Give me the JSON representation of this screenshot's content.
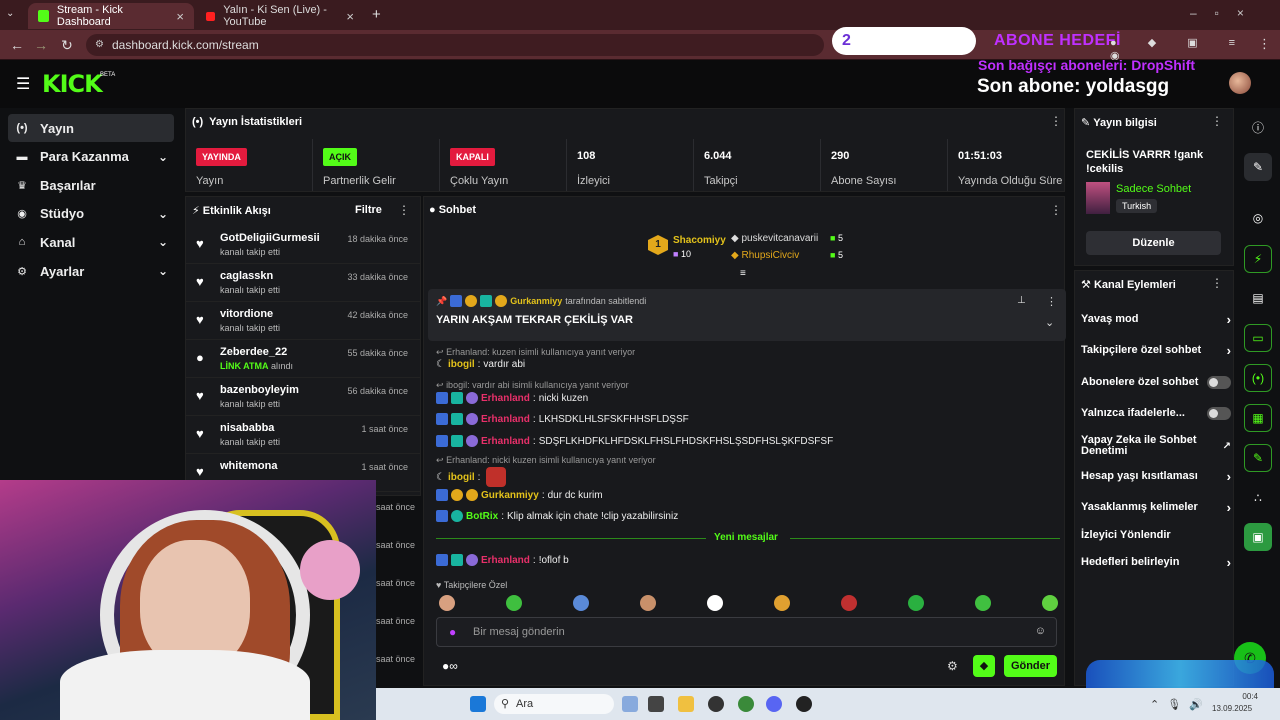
{
  "browser": {
    "tabs": [
      {
        "title": "Stream - Kick Dashboard",
        "active": true
      },
      {
        "title": "Yalın - Ki Sen (Live) - YouTube",
        "active": false
      }
    ],
    "url": "dashboard.kick.com/stream"
  },
  "overlay": {
    "goal_number": "2",
    "goal_label": "ABONE HEDEFİ",
    "last_donor": "Son bağışçı aboneleri: DropShift",
    "last_sub": "Son abone: yoldasgg"
  },
  "header": {
    "logo": "KICK",
    "beta": "BETA"
  },
  "sidebar": {
    "items": [
      {
        "label": "Yayın",
        "icon": "broadcast-icon",
        "active": true,
        "chevron": false
      },
      {
        "label": "Para Kazanma",
        "icon": "money-icon",
        "active": false,
        "chevron": true
      },
      {
        "label": "Başarılar",
        "icon": "trophy-icon",
        "active": false,
        "chevron": false
      },
      {
        "label": "Stüdyo",
        "icon": "studio-icon",
        "active": false,
        "chevron": true
      },
      {
        "label": "Kanal",
        "icon": "channel-icon",
        "active": false,
        "chevron": true
      },
      {
        "label": "Ayarlar",
        "icon": "gear-icon",
        "active": false,
        "chevron": true
      }
    ]
  },
  "stats": {
    "title": "Yayın İstatistikleri",
    "cells": [
      {
        "badge": "YAYINDA",
        "badge_color": "#e31b3e",
        "label": "Yayın"
      },
      {
        "badge": "AÇIK",
        "badge_color": "#53fc18",
        "label": "Partnerlik Gelir"
      },
      {
        "badge": "KAPALI",
        "badge_color": "#e31b3e",
        "label": "Çoklu Yayın"
      },
      {
        "value": "108",
        "label": "İzleyici"
      },
      {
        "value": "6.044",
        "label": "Takipçi"
      },
      {
        "value": "290",
        "label": "Abone Sayısı"
      },
      {
        "value": "01:51:03",
        "label": "Yayında Olduğu Süre"
      }
    ]
  },
  "activity": {
    "title": "Etkinlik Akışı",
    "filter": "Filtre",
    "items": [
      {
        "name": "GotDeligiiGurmesii",
        "sub": "kanalı takip etti",
        "time": "18 dakika önce",
        "icon": "heart"
      },
      {
        "name": "caglasskn",
        "sub": "kanalı takip etti",
        "time": "33 dakika önce",
        "icon": "heart"
      },
      {
        "name": "vitordione",
        "sub": "kanalı takip etti",
        "time": "42 dakika önce",
        "icon": "heart"
      },
      {
        "name": "Zeberdee_22",
        "sub_highlight": "LİNK ATMA",
        "sub": "alındı",
        "time": "55 dakika önce",
        "icon": "kick"
      },
      {
        "name": "bazenboyleyim",
        "sub": "kanalı takip etti",
        "time": "56 dakika önce",
        "icon": "heart"
      },
      {
        "name": "nisababba",
        "sub": "kanalı takip etti",
        "time": "1 saat önce",
        "icon": "heart"
      },
      {
        "name": "whitemona",
        "sub": "",
        "time": "1 saat önce",
        "icon": "heart"
      }
    ],
    "cut_times": [
      "saat önce",
      "saat önce",
      "saat önce",
      "saat önce",
      "saat önce",
      "saat önce"
    ]
  },
  "chat": {
    "title": "Sohbet",
    "top_gifters": [
      {
        "name": "Shacomiyy",
        "count": "10",
        "rank": "1"
      },
      {
        "name": "puskevitcanavarii",
        "count": "5"
      },
      {
        "name": "RhupsiCivciv",
        "count": "5"
      }
    ],
    "pinned_by": "Gurkanmiyy",
    "pinned_suffix": "tarafından sabitlendi",
    "pinned_text": "YARIN AKŞAM TEKRAR ÇEKİLİŞ VAR",
    "messages": [
      {
        "reply": "Erhanland: kuzen isimli kullanıcıya yanıt veriyor"
      },
      {
        "user": "ibogil",
        "color": "yel",
        "text": "vardır abi"
      },
      {
        "reply": "ibogil: vardır abi isimli kullanıcıya yanıt veriyor"
      },
      {
        "user": "Erhanland",
        "color": "pink",
        "text": "nicki kuzen"
      },
      {
        "user": "Erhanland",
        "color": "pink",
        "text": "LKHSDKLHLSFSKFHHSFLDŞSF"
      },
      {
        "user": "Erhanland",
        "color": "pink",
        "text": "SDŞFLKHDFKLHFDSKLFHSLFHDSKFHSLŞSDFHSLŞKFDSFSF"
      },
      {
        "reply": "Erhanland: nicki kuzen isimli kullanıcıya yanıt veriyor"
      },
      {
        "user": "ibogil",
        "color": "yel",
        "text": ""
      },
      {
        "user": "Gurkanmiyy",
        "color": "yel",
        "text": "dur dc kurim"
      },
      {
        "user": "BotRix",
        "color": "grn",
        "text": "Klip almak için chate !clip yazabilirsiniz"
      }
    ],
    "new_messages": "Yeni mesajlar",
    "last_message": {
      "user": "Erhanland",
      "text": "!oflof b"
    },
    "follower_only": "Takipçilere Özel",
    "placeholder": "Bir mesaj gönderin",
    "send": "Gönder"
  },
  "stream_info": {
    "title": "Yayın bilgisi",
    "stream_title": "CEKİLİS VARRR !gank !cekilis",
    "category": "Sadece Sohbet",
    "language": "Turkish",
    "edit": "Düzenle"
  },
  "channel_actions": {
    "title": "Kanal Eylemleri",
    "items": [
      {
        "label": "Yavaş mod",
        "kind": "chevron"
      },
      {
        "label": "Takipçilere özel sohbet",
        "kind": "chevron"
      },
      {
        "label": "Abonelere özel sohbet",
        "kind": "toggle"
      },
      {
        "label": "Yalnızca ifadelerle...",
        "kind": "toggle"
      },
      {
        "label": "Yapay Zeka ile Sohbet Denetimi",
        "kind": "external"
      },
      {
        "label": "Hesap yaşı kısıtlaması",
        "kind": "chevron"
      },
      {
        "label": "Yasaklanmış kelimeler",
        "kind": "chevron"
      },
      {
        "label": "İzleyici Yönlendir",
        "kind": "none"
      },
      {
        "label": "Hedefleri belirleyin",
        "kind": "chevron"
      }
    ]
  },
  "taskbar": {
    "search": "Ara",
    "date": "13.09.2025",
    "time": "00:4"
  }
}
